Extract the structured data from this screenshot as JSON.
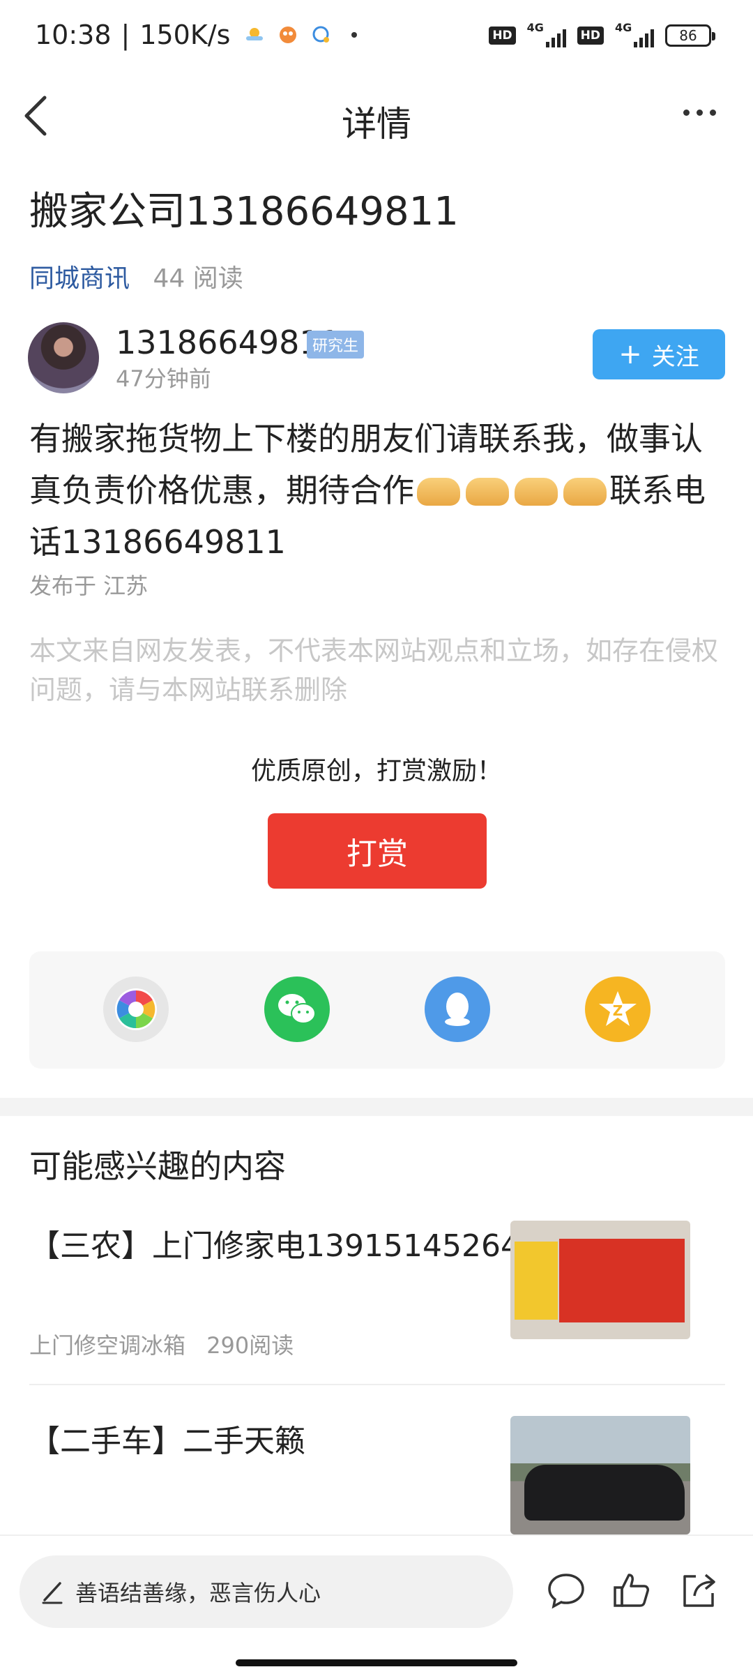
{
  "status_bar": {
    "time": "10:38",
    "speed": "150K/s",
    "battery": "86",
    "network_1": "HD",
    "network_1_type": "4G",
    "network_2": "HD",
    "network_2_type": "4G"
  },
  "header": {
    "title": "详情",
    "back_icon": "chevron-left-icon",
    "more_icon": "more-icon"
  },
  "article": {
    "title": "搬家公司13186649811",
    "category": "同城商讯",
    "reads": "44 阅读",
    "author": {
      "name": "13186649811",
      "badge": "研究生",
      "time": "47分钟前",
      "follow_label": "关注"
    },
    "body_1": "有搬家拖货物上下楼的朋友们请联系我，做事认真负责价格优惠，期待合作",
    "body_2": "联系电话13186649811",
    "location": "发布于 江苏",
    "disclaimer": "本文来自网友发表，不代表本网站观点和立场，如存在侵权问题，请与本网站联系删除"
  },
  "reward": {
    "text": "优质原创，打赏激励！",
    "button_label": "打赏"
  },
  "share": {
    "icons": [
      "moments-icon",
      "wechat-icon",
      "qq-icon",
      "qzone-icon"
    ]
  },
  "recommend": {
    "title": "可能感兴趣的内容",
    "items": [
      {
        "title": "【三农】上门修家电13915145264",
        "subtitle": "上门修空调冰箱",
        "reads": "290阅读"
      },
      {
        "title": "【二手车】二手天籁",
        "subtitle": "",
        "reads": ""
      }
    ]
  },
  "bottom_bar": {
    "comment_placeholder": "善语结善缘，恶言伤人心",
    "comment_icon": "comment-icon",
    "like_icon": "like-icon",
    "share_icon": "share-icon"
  },
  "colors": {
    "accent_blue": "#3ea6f2",
    "reward_red": "#ec3b30",
    "category_blue": "#2d5aa0"
  }
}
